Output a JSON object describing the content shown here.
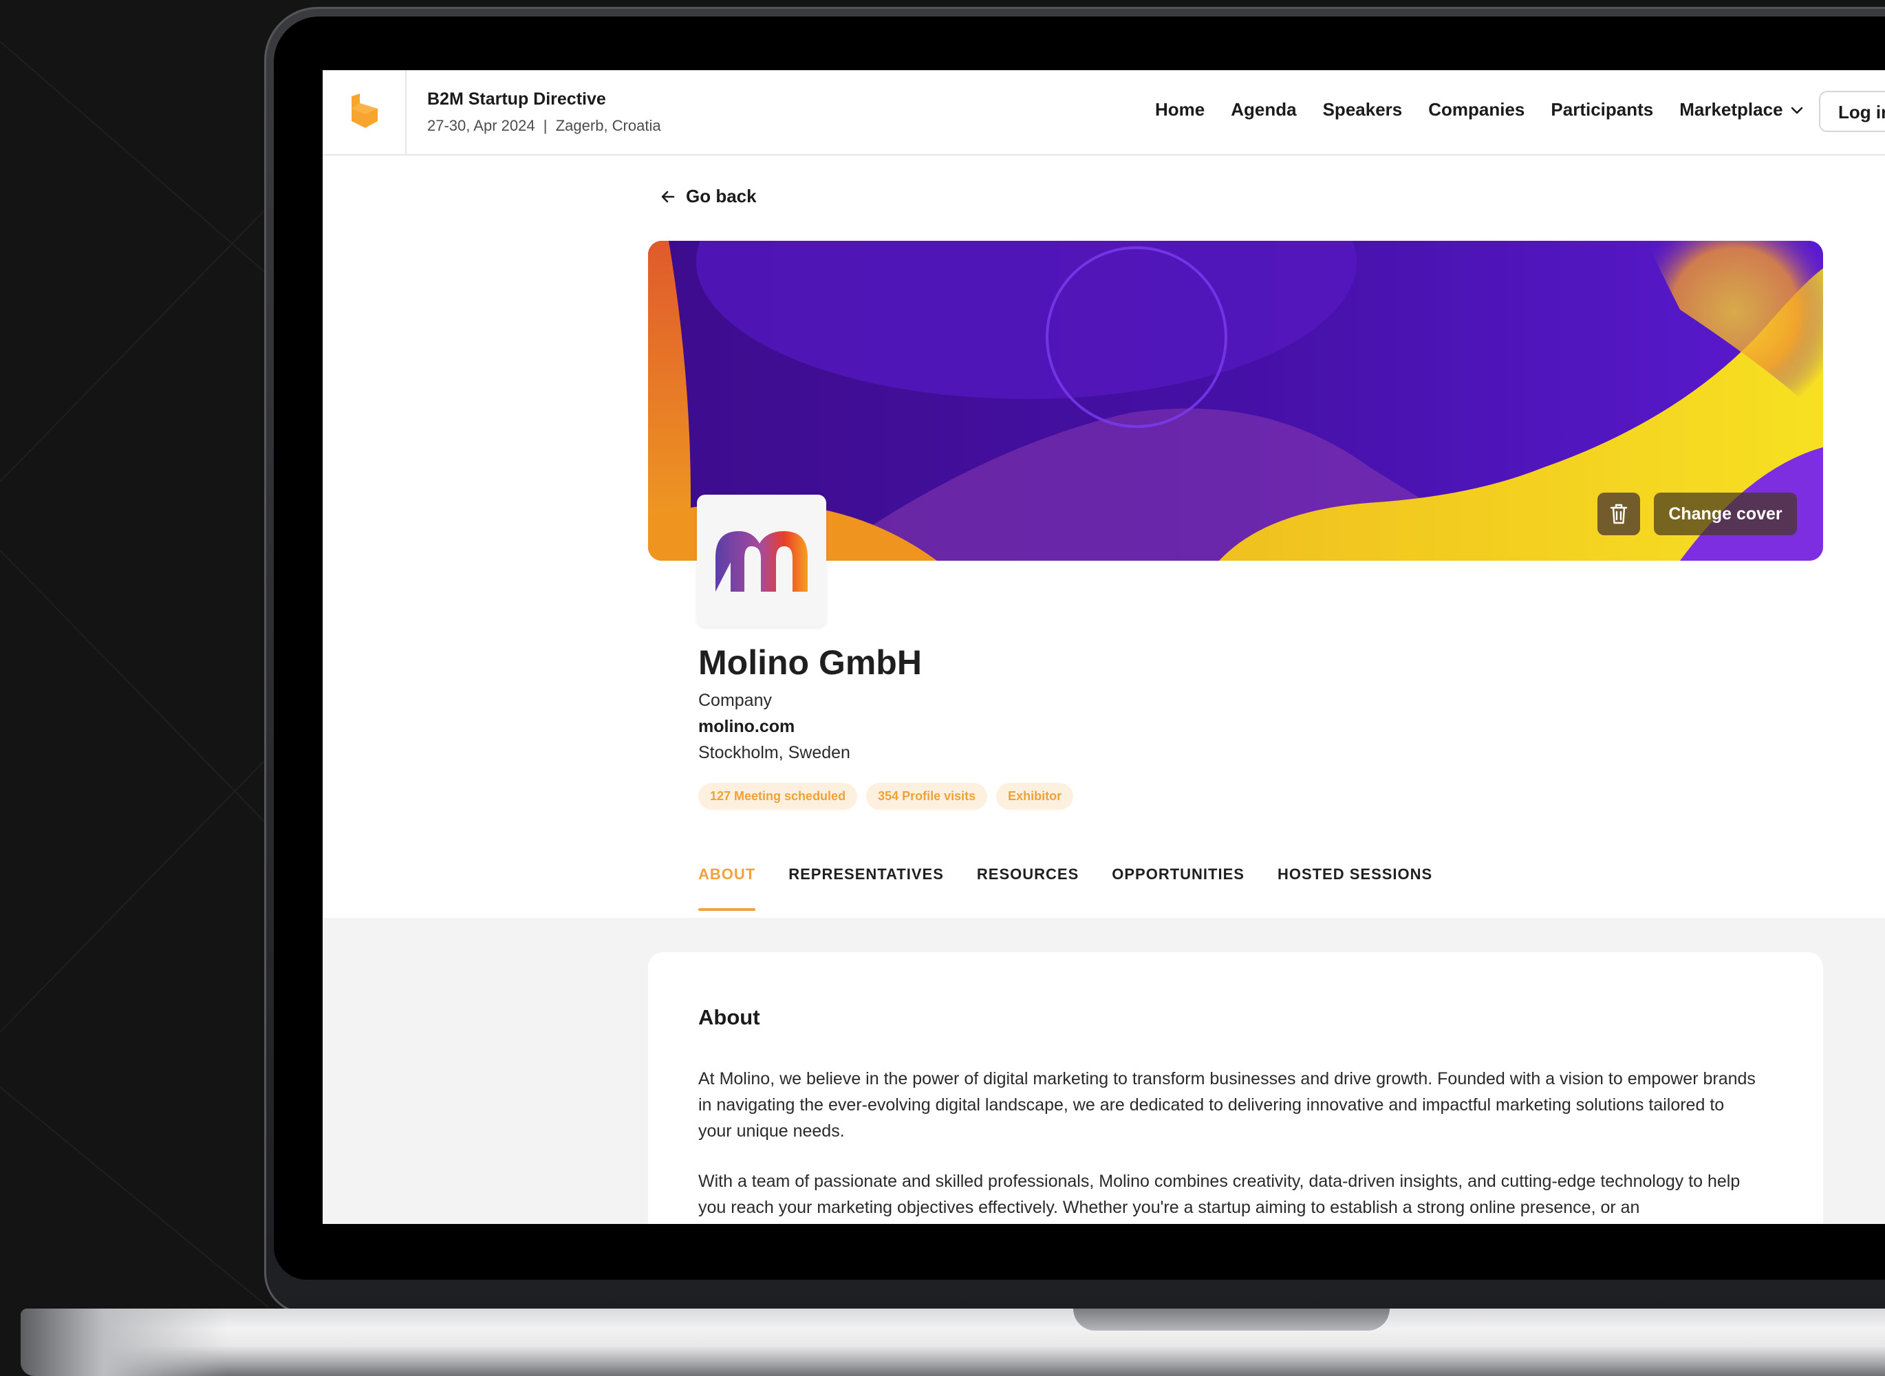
{
  "header": {
    "event_title": "B2M Startup Directive",
    "event_subtitle": "27-30, Apr 2024  |  Zagerb, Croatia",
    "nav": [
      "Home",
      "Agenda",
      "Speakers",
      "Companies",
      "Participants",
      "Marketplace"
    ],
    "login_label": "Log in",
    "brand_color": "#F7A52E"
  },
  "page": {
    "go_back_label": "Go back",
    "change_cover_label": "Change cover"
  },
  "company": {
    "name": "Molino GmbH",
    "type": "Company",
    "website": "molino.com",
    "location": "Stockholm, Sweden",
    "tags": [
      "127 Meeting scheduled",
      "354 Profile visits",
      "Exhibitor"
    ]
  },
  "tabs": {
    "items": [
      "ABOUT",
      "REPRESENTATIVES",
      "RESOURCES",
      "OPPORTUNITIES",
      "HOSTED SESSIONS"
    ],
    "active": "ABOUT",
    "accent_color": "#F2A23A"
  },
  "about": {
    "title": "About",
    "paragraph1": "At Molino, we believe in the power of digital marketing to transform businesses and drive growth. Founded with a vision to empower brands in navigating the ever-evolving digital landscape, we are dedicated to delivering innovative and impactful marketing solutions tailored to your unique needs.",
    "paragraph2": "With a team of passionate and skilled professionals, Molino combines creativity, data-driven insights, and cutting-edge technology to help you reach your marketing objectives effectively. Whether you're a startup aiming to establish a strong online presence, or an"
  },
  "icons": {
    "logo": "hexagon-logo-icon",
    "back": "arrow-left-icon",
    "chevron": "chevron-down-icon",
    "trash": "trash-icon",
    "company_logo": "molino-m-logo"
  }
}
